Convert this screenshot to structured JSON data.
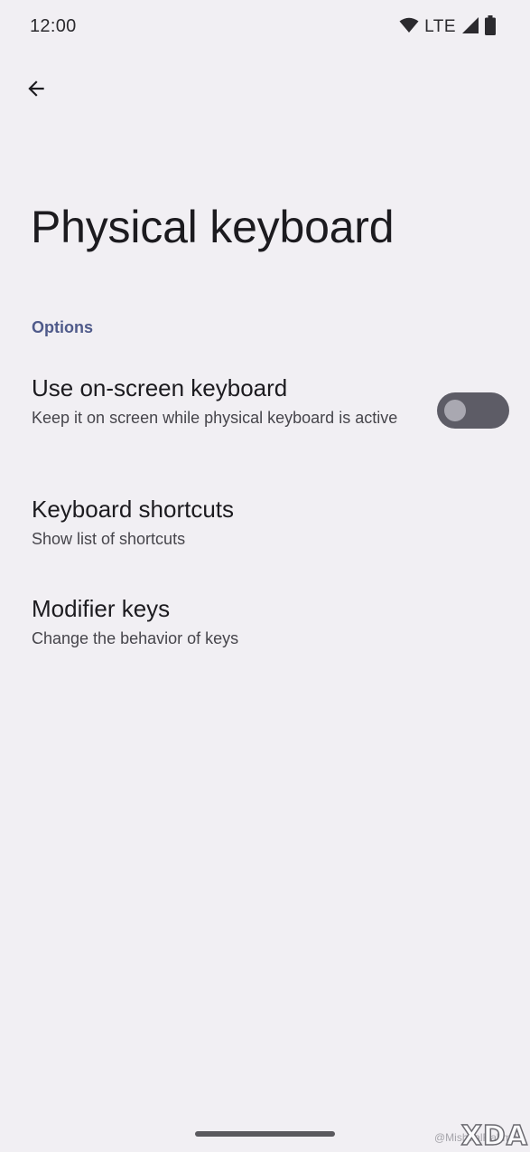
{
  "status_bar": {
    "time": "12:00",
    "network": "LTE",
    "icons": [
      "wifi-icon",
      "signal-icon",
      "battery-icon"
    ]
  },
  "header": {
    "back_icon": "arrow-back-icon",
    "title": "Physical keyboard"
  },
  "section": {
    "label": "Options"
  },
  "preferences": [
    {
      "title": "Use on-screen keyboard",
      "summary": "Keep it on screen while physical keyboard is active",
      "toggle": {
        "checked": false
      }
    },
    {
      "title": "Keyboard shortcuts",
      "summary": "Show list of shortcuts"
    },
    {
      "title": "Modifier keys",
      "summary": "Change the behavior of keys"
    }
  ],
  "watermark": {
    "credit": "@MishaalRahman",
    "logo": "XDA"
  },
  "colors": {
    "background": "#f1eff3",
    "accent": "#4f5a8a",
    "toggle_track_off": "#5d5c66",
    "toggle_thumb_off": "#a9a8b1"
  }
}
